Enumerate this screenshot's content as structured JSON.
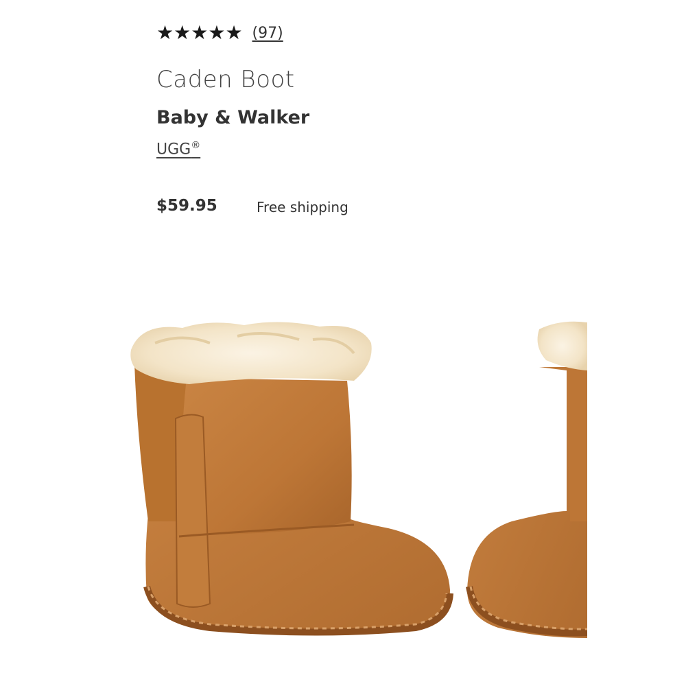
{
  "product": {
    "rating_stars": 5,
    "review_count": "(97)",
    "title": "Caden Boot",
    "subtitle": "Baby & Walker",
    "brand": "UGG",
    "brand_mark": "®",
    "price": "$59.95",
    "shipping": "Free shipping"
  },
  "icons": {
    "star": "star-icon"
  },
  "colors": {
    "suede": "#c07a3a",
    "fur": "#f4e9d2",
    "text": "#333333"
  }
}
